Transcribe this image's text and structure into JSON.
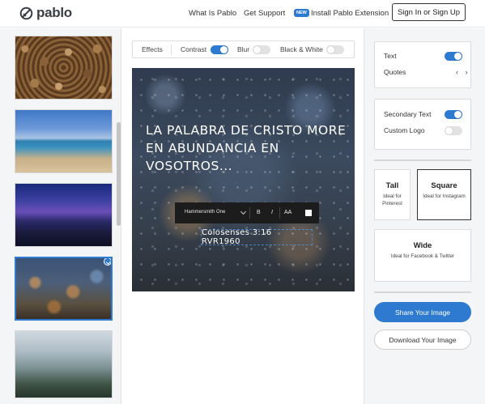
{
  "app": {
    "logo_text": "pablo"
  },
  "header": {
    "nav": [
      "What Is Pablo",
      "Get Support"
    ],
    "badge": "NEW",
    "install_label": "Install Pablo Extension",
    "signin_label": "Sign In or Sign Up"
  },
  "library": {
    "images": [
      {
        "subject": "stacked firewood logs"
      },
      {
        "subject": "beach and coastline"
      },
      {
        "subject": "purple night sky over town"
      },
      {
        "subject": "rain drops with bokeh lights",
        "selected": true
      },
      {
        "subject": "foggy mountains"
      }
    ]
  },
  "toolbar": {
    "effects_label": "Effects",
    "contrast_label": "Contrast",
    "contrast_on": true,
    "blur_label": "Blur",
    "blur_on": false,
    "bw_label": "Black & White",
    "bw_on": false
  },
  "canvas": {
    "quote": "LA PALABRA DE CRISTO MORE EN ABUNDANCIA EN VOSOTROS...",
    "source": "Colosenses 3:16 RVR1960",
    "fontbar": {
      "font_name": "Hammersmith One",
      "bold": "B",
      "italic": "I",
      "size": "AA"
    }
  },
  "options": {
    "text_label": "Text",
    "text_on": true,
    "quotes_label": "Quotes",
    "quotes_arrows": "‹ ›",
    "secondary_label": "Secondary Text",
    "secondary_on": true,
    "custom_logo_label": "Custom Logo",
    "custom_logo_on": false
  },
  "sizes": [
    {
      "title": "Tall",
      "sub": "Ideal for Pinterest",
      "active": false
    },
    {
      "title": "Square",
      "sub": "Ideal for Instagram",
      "active": true
    },
    {
      "title": "Wide",
      "sub": "Ideal for Facebook & Twitter",
      "active": false
    }
  ],
  "actions": {
    "share_label": "Share Your Image",
    "download_label": "Download Your Image"
  },
  "colors": {
    "accent": "#2e7ad1",
    "toggle_off": "#e2e2e2"
  }
}
